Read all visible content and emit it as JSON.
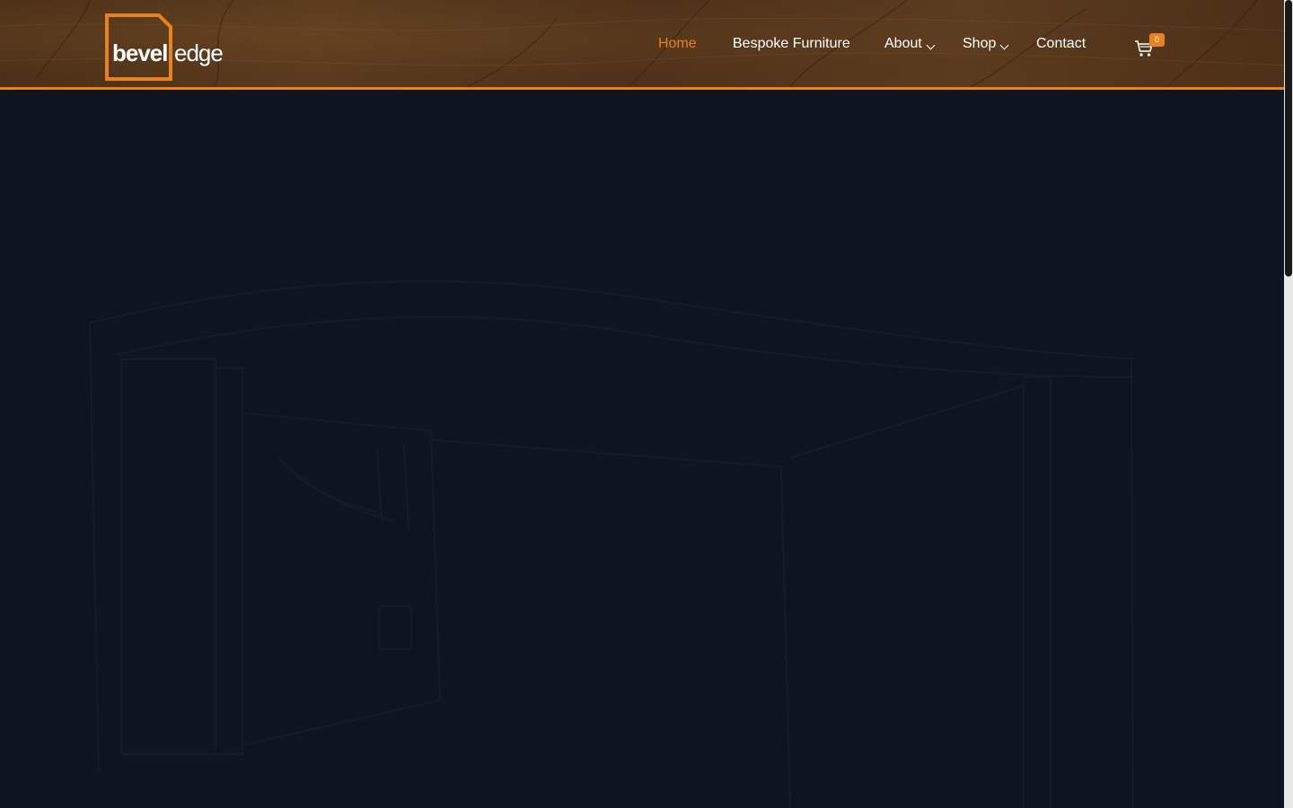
{
  "brand": {
    "logo_part1": "bevel",
    "logo_part2": "edge",
    "accent_color": "#e8821e"
  },
  "nav": {
    "items": [
      {
        "label": "Home",
        "active": true
      },
      {
        "label": "Bespoke Furniture"
      },
      {
        "label": "About",
        "dropdown": true
      },
      {
        "label": "Shop",
        "dropdown": true
      },
      {
        "label": "Contact"
      }
    ]
  },
  "cart": {
    "icon": "cart-icon",
    "count": "0"
  }
}
